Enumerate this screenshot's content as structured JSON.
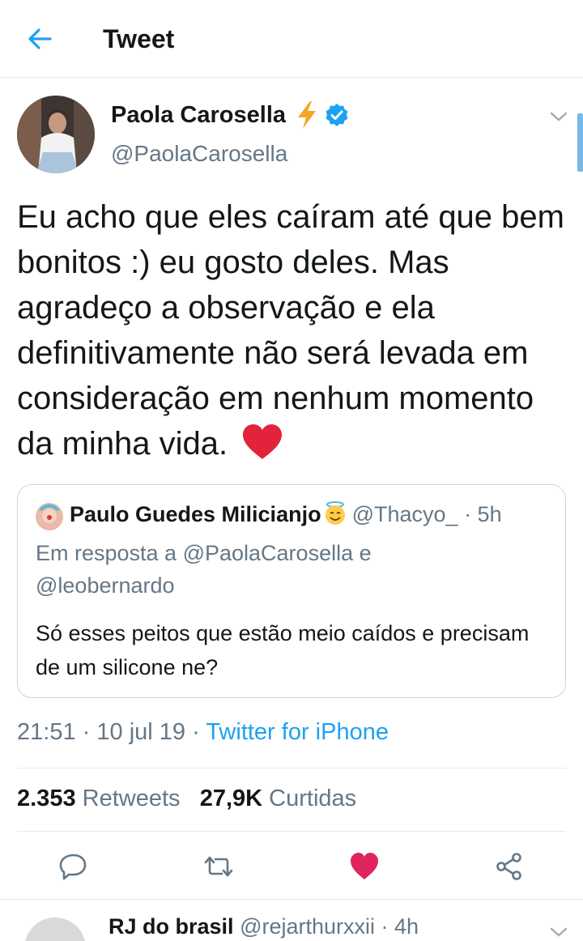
{
  "header": {
    "title": "Tweet",
    "back_icon": "arrow-left-icon"
  },
  "tweet": {
    "author_name": "Paola Carosella",
    "author_handle": "@PaolaCarosella",
    "text": "Eu acho que eles caíram até que bem bonitos :) eu gosto deles. Mas agradeço a observação e ela definitivamente não será levada em consideração em nenhum momento da minha vida.",
    "time": "21:51",
    "date": "10 jul 19",
    "source": "Twitter for iPhone",
    "separator": "·",
    "retweets_count": "2.353",
    "retweets_label": "Retweets",
    "likes_count": "27,9K",
    "likes_label": "Curtidas"
  },
  "quote": {
    "author_name": "Paulo Guedes Milicianjo",
    "author_handle": "@Thacyo_",
    "age": "· 5h",
    "reply_line1": "Em resposta a @PaolaCarosella e",
    "reply_line2": "@leobernardo",
    "text": "Só esses peitos que estão meio caídos e precisam de um silicone ne?"
  },
  "next_tweet": {
    "author_name": "RJ do brasil",
    "author_handle": "@rejarthurxxii",
    "age": "· 4h"
  },
  "colors": {
    "accent": "#1da1f2",
    "text": "#14171a",
    "secondary": "#657786",
    "border": "#e6ecf0",
    "like": "#e0245e"
  }
}
